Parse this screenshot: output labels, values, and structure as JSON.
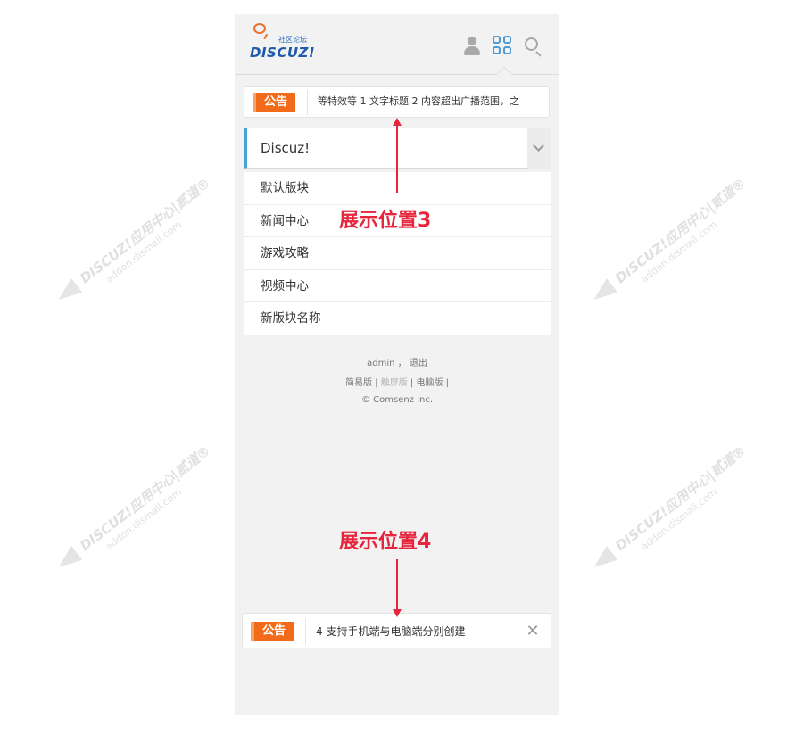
{
  "logo": {
    "cn": "社区论坛",
    "en": "DISCUZ!"
  },
  "header_icons": [
    "user-icon",
    "grid-icon",
    "search-icon"
  ],
  "announcement_top": {
    "badge": "公告",
    "text": "等特效等  1 文字标题  2 内容超出广播范围，之"
  },
  "forum": {
    "title": "Discuz!",
    "items": [
      "默认版块",
      "新闻中心",
      "游戏攻略",
      "视频中心",
      "新版块名称"
    ]
  },
  "footer": {
    "user": "admin",
    "comma": "，",
    "logout": "退出",
    "simple": "简易版",
    "touch": "触屏版",
    "pc": "电脑版",
    "sep": "|",
    "copyright": "© Comsenz Inc."
  },
  "announcement_bottom": {
    "badge": "公告",
    "text": "4 支持手机端与电脑端分别创建",
    "close": "✕"
  },
  "annotations": {
    "pos3": "展示位置3",
    "pos4": "展示位置4"
  },
  "watermark": {
    "brand": "DISCUZ!应用中心|贰道®",
    "url": "addon.dismall.com"
  },
  "colors": {
    "accent_red": "#e5263d",
    "badge_orange": "#f26b1b",
    "forum_blue": "#4a9fd8"
  }
}
